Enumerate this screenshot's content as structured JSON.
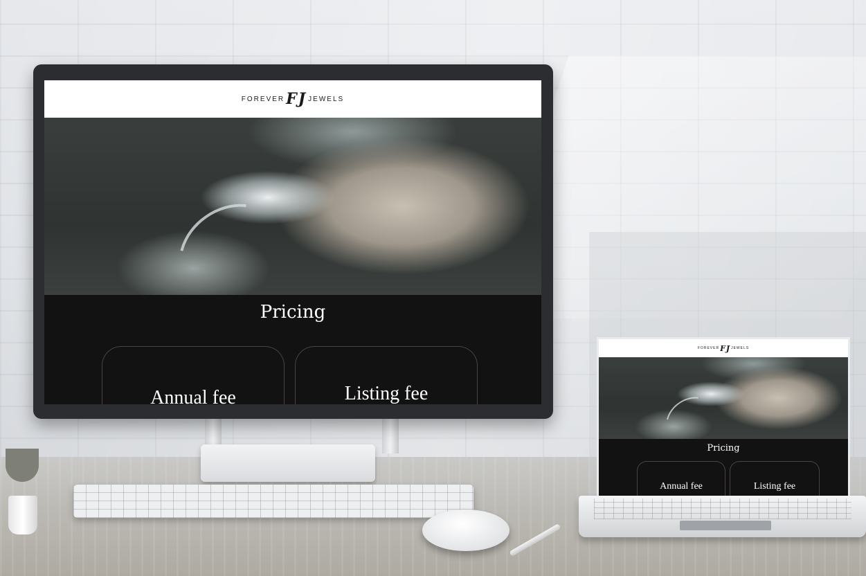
{
  "site": {
    "brand_left": "FOREVER",
    "brand_mark": "FJ",
    "brand_right": "JEWELS",
    "section_title": "Pricing",
    "cards": [
      {
        "label": "Annual fee"
      },
      {
        "label": "Listing fee"
      }
    ]
  },
  "colors": {
    "header_bg": "#ffffff",
    "page_bg": "#121213",
    "card_border": "#4a4540",
    "text_light": "#ffffff"
  }
}
